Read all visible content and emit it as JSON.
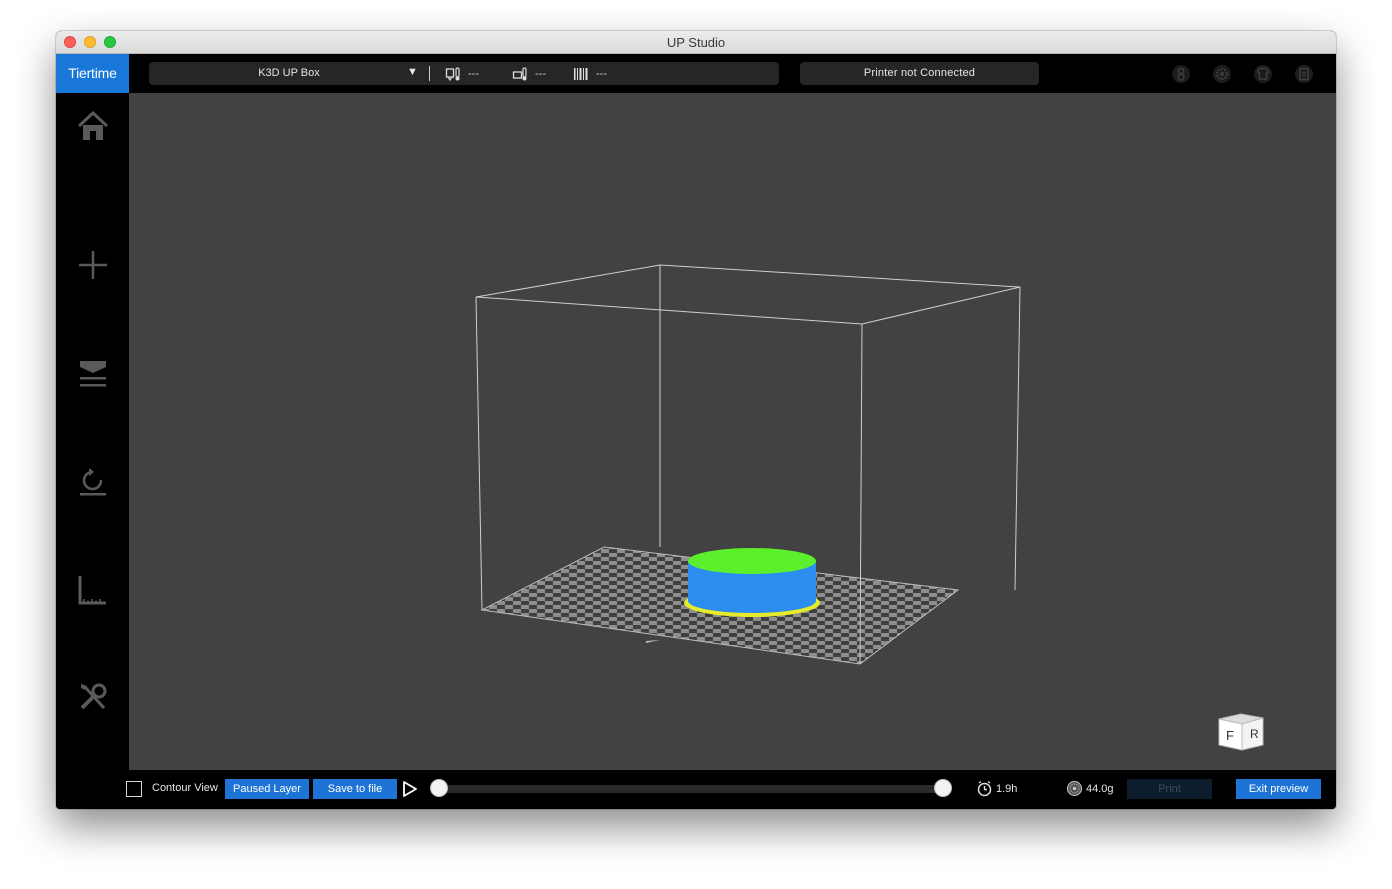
{
  "window": {
    "title": "UP Studio"
  },
  "topbar": {
    "logo": "Tiertime",
    "printer_name": "K3D UP Box",
    "nozzle_temp": "---",
    "bed_temp": "---",
    "material": "---",
    "status": "Printer not Connected",
    "icons": [
      "account-icon",
      "settings-icon",
      "shirt-icon",
      "clipboard-icon"
    ]
  },
  "sidebar": {
    "items": [
      "home-icon",
      "add-icon",
      "print-icon",
      "calibrate-icon",
      "level-icon",
      "maintenance-icon"
    ]
  },
  "viewport": {
    "nav_cube": {
      "front": "F",
      "right": "R"
    },
    "colors": {
      "background": "#424242",
      "model_body": "#2c8df0",
      "model_top": "#5cef2c",
      "model_edge": "#e6ec2a"
    }
  },
  "bottombar": {
    "contour_label": "Contour View",
    "contour_checked": false,
    "paused_layer_label": "Paused Layer",
    "save_to_file_label": "Save to file",
    "layer_range": {
      "start": 0,
      "end": 1
    },
    "time": "1.9h",
    "weight": "44.0g",
    "print_label": "Print",
    "exit_preview_label": "Exit preview"
  },
  "colors": {
    "accent": "#1d74d6"
  }
}
